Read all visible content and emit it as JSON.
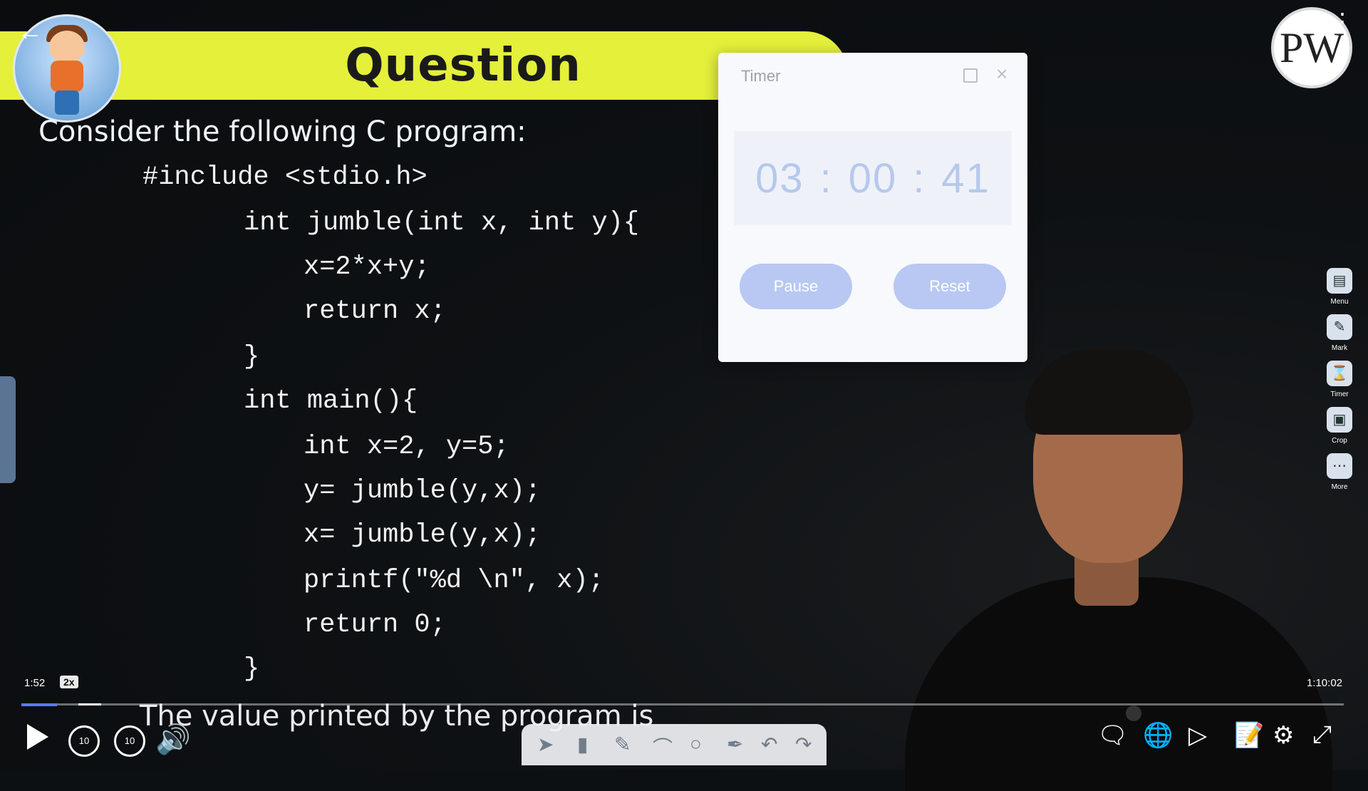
{
  "slide": {
    "title": "Question",
    "subtitle": "Consider the following C program:",
    "code_lines": [
      "#include <stdio.h>",
      "int jumble(int x, int y){",
      "x=2*x+y;",
      "return x;",
      "}",
      "int main(){",
      "int x=2, y=5;",
      "y= jumble(y,x);",
      "x= jumble(y,x);",
      "printf(\"%d \\n\", x);",
      "return 0;",
      "}"
    ],
    "bottom_text": "The value printed by the program is"
  },
  "timer": {
    "title": "Timer",
    "hours": "03",
    "minutes": "00",
    "seconds": "41",
    "separator": ":",
    "pause_label": "Pause",
    "reset_label": "Reset"
  },
  "logo": {
    "text": "PW"
  },
  "right_rail": [
    {
      "label": "Menu",
      "icon": "menu-icon"
    },
    {
      "label": "Mark",
      "icon": "pencil-icon"
    },
    {
      "label": "Timer",
      "icon": "hourglass-icon"
    },
    {
      "label": "Crop",
      "icon": "crop-icon"
    },
    {
      "label": "More",
      "icon": "more-icon"
    }
  ],
  "player": {
    "current_time": "1:52",
    "speed": "2x",
    "total_time": "1:10:02",
    "progress_fraction": 0.027,
    "rewind_label": "10",
    "forward_label": "10",
    "accent_color": "#5b79ff"
  }
}
